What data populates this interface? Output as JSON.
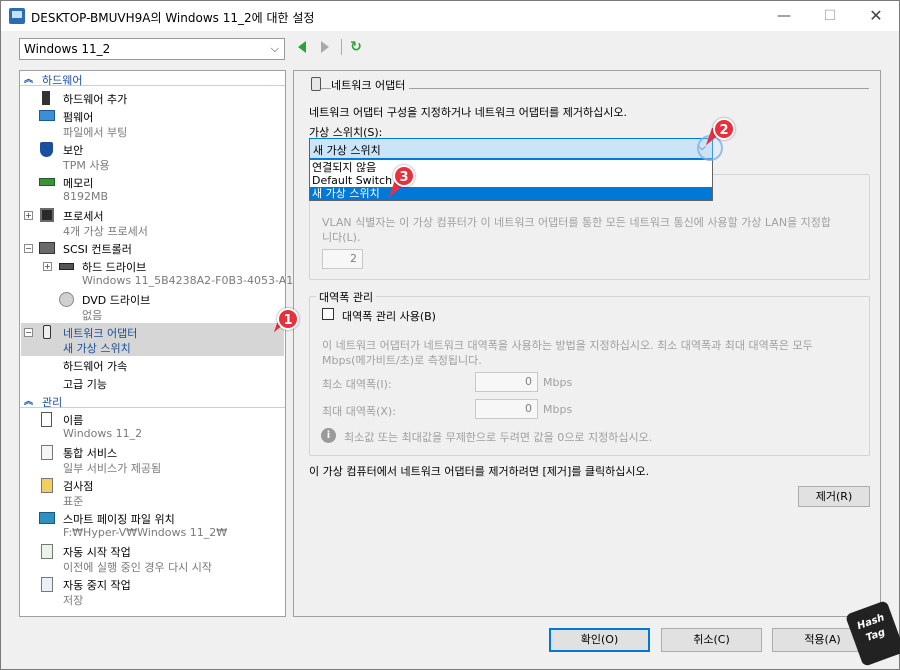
{
  "window": {
    "title": "DESKTOP-BMUVH9A의 Windows 11_2에 대한 설정",
    "minimize": "—",
    "maximize": "☐",
    "close": "✕"
  },
  "vm_selector": {
    "value": "Windows 11_2"
  },
  "sidebar": {
    "hardware_header": "하드웨어",
    "add_hardware": "하드웨어 추가",
    "firmware": {
      "label": "펌웨어",
      "detail": "파일에서 부팅"
    },
    "security": {
      "label": "보안",
      "detail": "TPM 사용"
    },
    "memory": {
      "label": "메모리",
      "detail": "8192MB"
    },
    "processor": {
      "label": "프로세서",
      "detail": "4개 가상 프로세서"
    },
    "scsi": {
      "label": "SCSI 컨트롤러"
    },
    "hard_drive": {
      "label": "하드 드라이브",
      "detail": "Windows 11_5B4238A2-F0B3-4053-A1..."
    },
    "dvd_drive": {
      "label": "DVD 드라이브",
      "detail": "없음"
    },
    "network_adapter": {
      "label": "네트워크 어댑터",
      "detail": "새 가상 스위치"
    },
    "hw_acceleration": "하드웨어 가속",
    "advanced": "고급 기능",
    "management_header": "관리",
    "name": {
      "label": "이름",
      "detail": "Windows 11_2"
    },
    "integration": {
      "label": "통합 서비스",
      "detail": "일부 서비스가 제공됨"
    },
    "checkpoints": {
      "label": "검사점",
      "detail": "표준"
    },
    "smart_paging": {
      "label": "스마트 페이징 파일 위치",
      "detail": "F:₩Hyper-V₩Windows 11_2₩"
    },
    "auto_start": {
      "label": "자동 시작 작업",
      "detail": "이전에 실행 중인 경우 다시 시작"
    },
    "auto_stop": {
      "label": "자동 중지 작업",
      "detail": "저장"
    }
  },
  "panel": {
    "header": "네트워크 어댑터",
    "description": "네트워크 어댑터 구성을 지정하거나 네트워크 어댑터를 제거하십시오.",
    "switch_label": "가상 스위치(S):",
    "switch_value": "새 가상 스위치",
    "switch_options": [
      "연결되지 않음",
      "Default Switch",
      "새 가상 스위치"
    ],
    "vlan_text_1": "VLAN 식별자는 이 가상 컴퓨터가 이 네트워크 어댑터를 통한 모든 네트워크 통신에 사용할 가상  LAN을 지정합",
    "vlan_text_2": "니다(L).",
    "vlan_value": "2",
    "bandwidth_header": "대역폭 관리",
    "bandwidth_enable": "대역폭 관리 사용(B)",
    "bandwidth_desc_1": "이 네트워크 어댑터가 네트워크 대역폭을 사용하는 방법을 지정하십시오. 최소 대역폭과 최대 대역폭은 모두",
    "bandwidth_desc_2": "Mbps(메가비트/초)로 측정됩니다.",
    "min_label": "최소 대역폭(I):",
    "min_value": "0",
    "max_label": "최대 대역폭(X):",
    "max_value": "0",
    "unit": "Mbps",
    "info_text": "최소값 또는 최대값을 무제한으로 두려면 값을 0으로 지정하십시오.",
    "remove_text": "이 가상 컴퓨터에서 네트워크 어댑터를 제거하려면 [제거]를 클릭하십시오.",
    "remove_button": "제거(R)"
  },
  "footer": {
    "ok": "확인(O)",
    "cancel": "취소(C)",
    "apply": "적용(A)"
  },
  "annotations": {
    "one": "1",
    "two": "2",
    "three": "3"
  },
  "watermark": "Hash Tag",
  "colors": {
    "accent": "#0078d7",
    "section": "#1a4f9a",
    "badge": "#e8303d"
  }
}
